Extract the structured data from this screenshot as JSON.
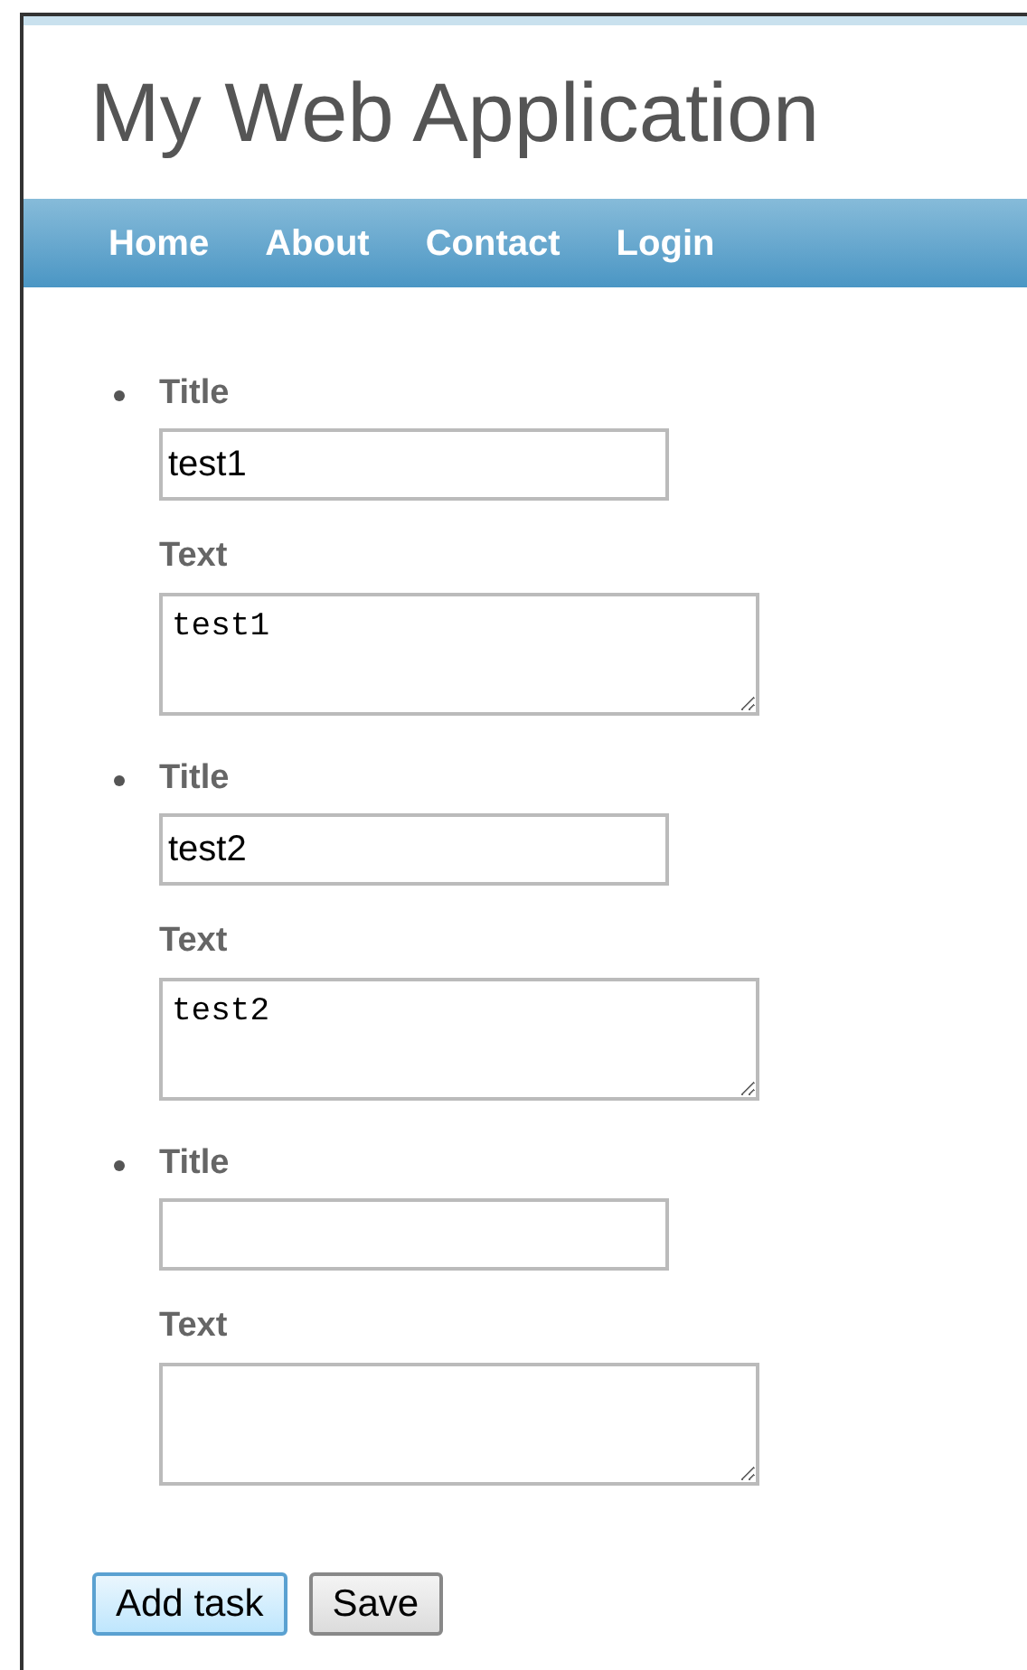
{
  "header": {
    "title": "My Web Application"
  },
  "nav": [
    {
      "label": "Home"
    },
    {
      "label": "About"
    },
    {
      "label": "Contact"
    },
    {
      "label": "Login"
    }
  ],
  "tasks": [
    {
      "title_label": "Title",
      "title_value": "test1",
      "text_label": "Text",
      "text_value": "test1"
    },
    {
      "title_label": "Title",
      "title_value": "test2",
      "text_label": "Text",
      "text_value": "test2"
    },
    {
      "title_label": "Title",
      "text_label": "Text"
    }
  ],
  "buttons": [
    {
      "label": "Add task",
      "focused": true
    },
    {
      "label": "Save",
      "focused": false
    }
  ]
}
